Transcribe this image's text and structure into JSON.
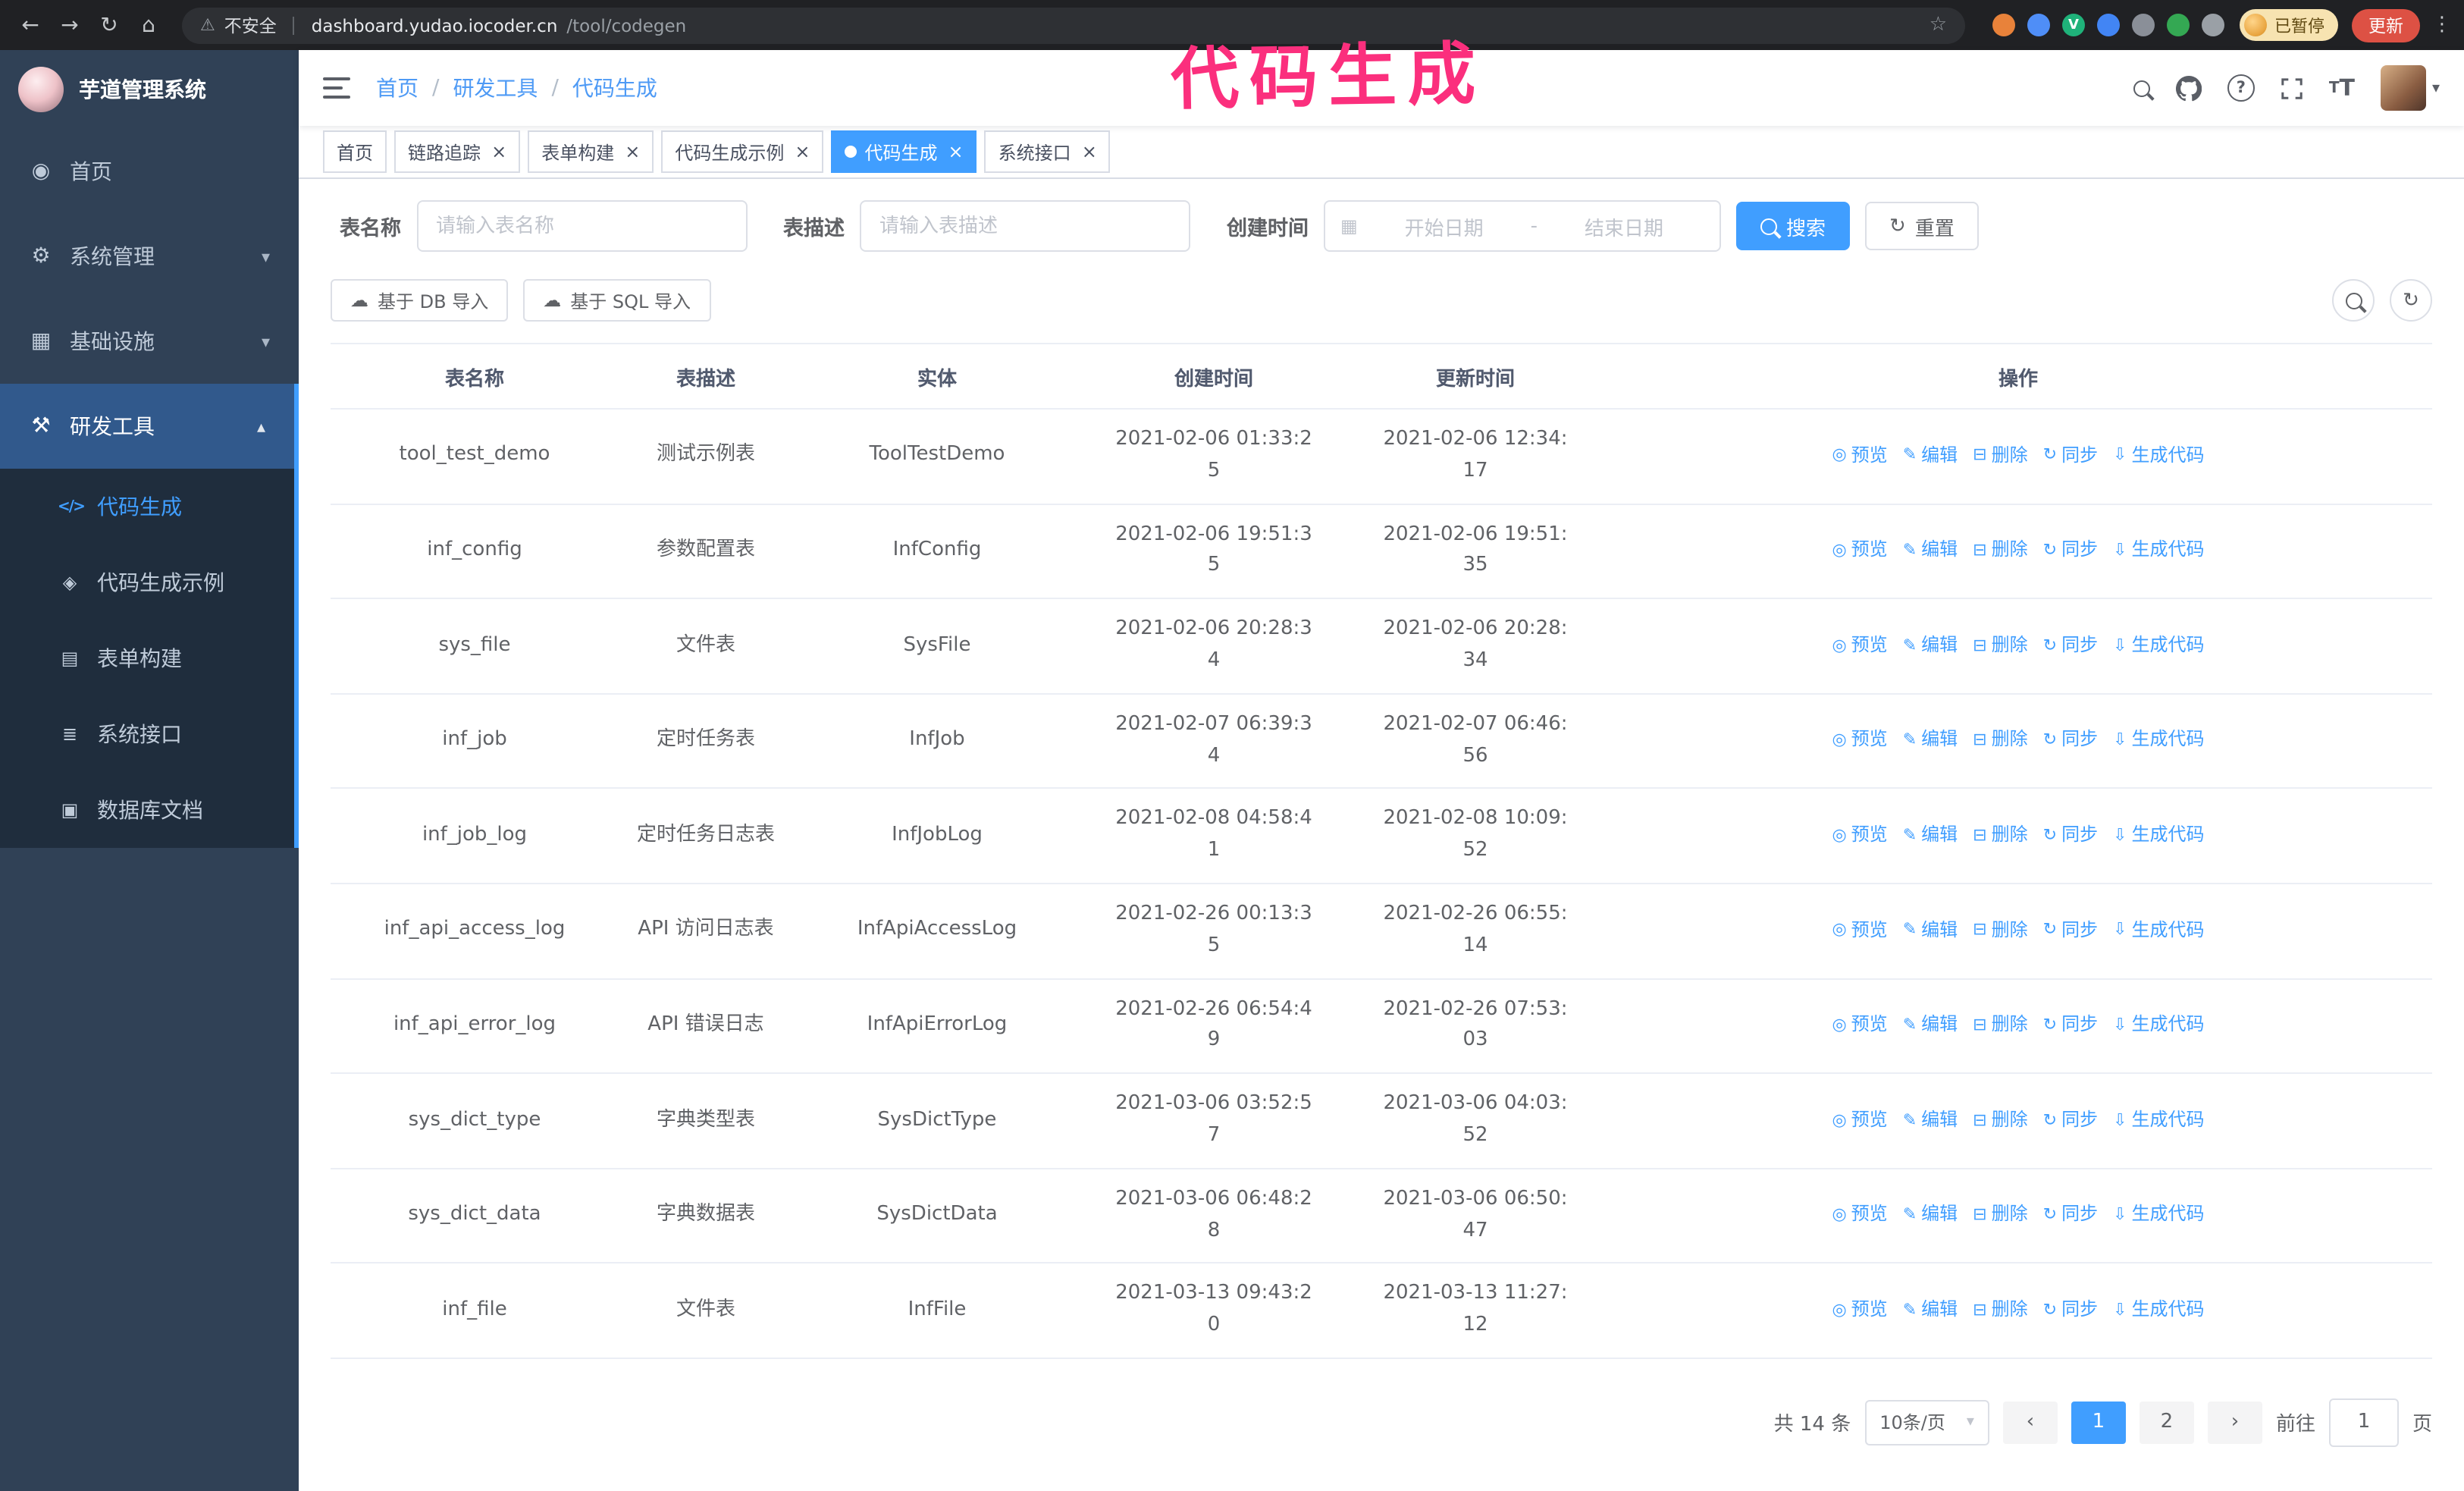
{
  "annotation": {
    "text": "代码生成",
    "color": "#fb2f7d"
  },
  "browser": {
    "security_label": "不安全",
    "url_host": "dashboard.yudao.iocoder.cn",
    "url_path": "/tool/codegen",
    "paused_label": "已暂停",
    "update_label": "更新",
    "extensions": [
      {
        "name": "fox-extension",
        "color": "#e8823a"
      },
      {
        "name": "drop-extension",
        "color": "#4f8ef7"
      },
      {
        "name": "check-extension",
        "color": "#1fb27a",
        "glyph": "V"
      },
      {
        "name": "people-extension",
        "color": "#4285f4"
      },
      {
        "name": "grid-extension",
        "color": "#8a8f98"
      },
      {
        "name": "leaf-extension",
        "color": "#34a853"
      },
      {
        "name": "puzzle-extension",
        "color": "#9aa0a6"
      }
    ]
  },
  "icons": {
    "back": "←",
    "forward": "→",
    "reload": "↻",
    "home": "⌂",
    "warning": "⚠",
    "star": "☆",
    "dots": "⋮",
    "close": "×",
    "chevron_down": "▾",
    "chevron_up": "▴",
    "caret_down": "▾",
    "prev": "‹",
    "next": "›",
    "cloud_upload": "☁",
    "calendar": "▦",
    "question": "?"
  },
  "sidebar": {
    "app_title": "芋道管理系统",
    "items": [
      {
        "label": "首页",
        "icon": "◉"
      },
      {
        "label": "系统管理",
        "icon": "⚙"
      },
      {
        "label": "基础设施",
        "icon": "▦"
      },
      {
        "label": "研发工具",
        "icon": "⚒"
      }
    ],
    "subitems": [
      {
        "label": "代码生成",
        "icon": "</>"
      },
      {
        "label": "代码生成示例",
        "icon": "◈"
      },
      {
        "label": "表单构建",
        "icon": "▤"
      },
      {
        "label": "系统接口",
        "icon": "≣"
      },
      {
        "label": "数据库文档",
        "icon": "▣"
      }
    ]
  },
  "topbar": {
    "breadcrumb": [
      "首页",
      "研发工具",
      "代码生成"
    ]
  },
  "tabs": [
    {
      "label": "首页"
    },
    {
      "label": "链路追踪"
    },
    {
      "label": "表单构建"
    },
    {
      "label": "代码生成示例"
    },
    {
      "label": "代码生成"
    },
    {
      "label": "系统接口"
    }
  ],
  "filters": {
    "table_name_label": "表名称",
    "table_name_placeholder": "请输入表名称",
    "table_desc_label": "表描述",
    "table_desc_placeholder": "请输入表描述",
    "create_time_label": "创建时间",
    "date_start_placeholder": "开始日期",
    "date_separator": "-",
    "date_end_placeholder": "结束日期",
    "search_label": "搜索",
    "reset_label": "重置"
  },
  "toolbar": {
    "import_db": "基于 DB 导入",
    "import_sql": "基于 SQL 导入"
  },
  "table": {
    "columns": [
      "表名称",
      "表描述",
      "实体",
      "创建时间",
      "更新时间",
      "操作"
    ],
    "actions": [
      {
        "name": "preview",
        "icon": "◎",
        "label": "预览"
      },
      {
        "name": "edit",
        "icon": "✎",
        "label": "编辑"
      },
      {
        "name": "delete",
        "icon": "⊟",
        "label": "删除"
      },
      {
        "name": "sync",
        "icon": "↻",
        "label": "同步"
      },
      {
        "name": "generate",
        "icon": "⇩",
        "label": "生成代码"
      }
    ],
    "rows": [
      {
        "name": "tool_test_demo",
        "desc": "测试示例表",
        "entity": "ToolTestDemo",
        "created": "2021-02-06 01:33:25",
        "updated": "2021-02-06 12:34:17"
      },
      {
        "name": "inf_config",
        "desc": "参数配置表",
        "entity": "InfConfig",
        "created": "2021-02-06 19:51:35",
        "updated": "2021-02-06 19:51:35"
      },
      {
        "name": "sys_file",
        "desc": "文件表",
        "entity": "SysFile",
        "created": "2021-02-06 20:28:34",
        "updated": "2021-02-06 20:28:34"
      },
      {
        "name": "inf_job",
        "desc": "定时任务表",
        "entity": "InfJob",
        "created": "2021-02-07 06:39:34",
        "updated": "2021-02-07 06:46:56"
      },
      {
        "name": "inf_job_log",
        "desc": "定时任务日志表",
        "entity": "InfJobLog",
        "created": "2021-02-08 04:58:41",
        "updated": "2021-02-08 10:09:52"
      },
      {
        "name": "inf_api_access_log",
        "desc": "API 访问日志表",
        "entity": "InfApiAccessLog",
        "created": "2021-02-26 00:13:35",
        "updated": "2021-02-26 06:55:14"
      },
      {
        "name": "inf_api_error_log",
        "desc": "API 错误日志",
        "entity": "InfApiErrorLog",
        "created": "2021-02-26 06:54:49",
        "updated": "2021-02-26 07:53:03"
      },
      {
        "name": "sys_dict_type",
        "desc": "字典类型表",
        "entity": "SysDictType",
        "created": "2021-03-06 03:52:57",
        "updated": "2021-03-06 04:03:52"
      },
      {
        "name": "sys_dict_data",
        "desc": "字典数据表",
        "entity": "SysDictData",
        "created": "2021-03-06 06:48:28",
        "updated": "2021-03-06 06:50:47"
      },
      {
        "name": "inf_file",
        "desc": "文件表",
        "entity": "InfFile",
        "created": "2021-03-13 09:43:20",
        "updated": "2021-03-13 11:27:12"
      }
    ]
  },
  "pagination": {
    "total": "共 14 条",
    "page_size": "10条/页",
    "pages": [
      "1",
      "2"
    ],
    "active_page": "1",
    "goto_label": "前往",
    "goto_value": "1",
    "goto_unit": "页"
  }
}
